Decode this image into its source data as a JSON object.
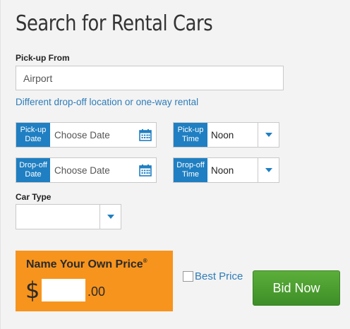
{
  "title": "Search for Rental Cars",
  "pickup": {
    "label": "Pick-up From",
    "value": "Airport"
  },
  "different_dropoff_link": "Different drop-off location or one-way rental",
  "pickup_date": {
    "tag": "Pick-up Date",
    "placeholder": "Choose Date"
  },
  "pickup_time": {
    "tag": "Pick-up Time",
    "value": "Noon"
  },
  "dropoff_date": {
    "tag": "Drop-off Date",
    "placeholder": "Choose Date"
  },
  "dropoff_time": {
    "tag": "Drop-off Time",
    "value": "Noon"
  },
  "car_type": {
    "label": "Car Type",
    "value": ""
  },
  "price": {
    "title": "Name Your Own Price",
    "registered": "®",
    "currency": "$",
    "cents": ".00",
    "value": ""
  },
  "best_price": {
    "label": "Best Price",
    "checked": false
  },
  "bid_button": "Bid Now",
  "colors": {
    "accent_blue": "#1f7fc2",
    "link_blue": "#2e7cb8",
    "price_orange": "#f7941d",
    "bid_green": "#4a9e30"
  },
  "icons": {
    "calendar": "calendar-icon",
    "dropdown": "chevron-down-icon"
  }
}
